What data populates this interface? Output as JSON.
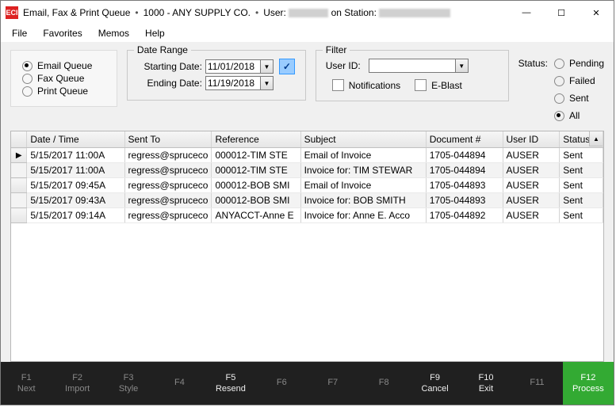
{
  "title": {
    "app_label": "ECI",
    "window_title": "Email, Fax & Print Queue",
    "account": "1000 - ANY SUPPLY CO.",
    "user_label": "User:",
    "station_label": "on Station:"
  },
  "menu": {
    "file": "File",
    "favorites": "Favorites",
    "memos": "Memos",
    "help": "Help"
  },
  "queue": {
    "email": "Email Queue",
    "fax": "Fax Queue",
    "print": "Print Queue",
    "selected": "email"
  },
  "daterange": {
    "legend": "Date Range",
    "start_lbl": "Starting Date:",
    "end_lbl": "Ending Date:",
    "start": "11/01/2018",
    "end": "11/19/2018"
  },
  "filter": {
    "legend": "Filter",
    "user_lbl": "User ID:",
    "user_value": "",
    "notifications": "Notifications",
    "eblast": "E-Blast"
  },
  "status": {
    "label": "Status:",
    "pending": "Pending",
    "failed": "Failed",
    "sent": "Sent",
    "all": "All",
    "selected": "all"
  },
  "grid": {
    "headers": {
      "datetime": "Date / Time",
      "sent_to": "Sent To",
      "reference": "Reference",
      "subject": "Subject",
      "document": "Document #",
      "user": "User ID",
      "status": "Status"
    },
    "rows": [
      {
        "dt": "5/15/2017 11:00A",
        "to": "regress@spruceco",
        "ref": "000012-TIM STE",
        "subj": "Email of Invoice",
        "doc": "1705-044894",
        "uid": "AUSER",
        "st": "Sent"
      },
      {
        "dt": "5/15/2017 11:00A",
        "to": "regress@spruceco",
        "ref": "000012-TIM STE",
        "subj": "Invoice for: TIM STEWAR",
        "doc": "1705-044894",
        "uid": "AUSER",
        "st": "Sent"
      },
      {
        "dt": "5/15/2017 09:45A",
        "to": "regress@spruceco",
        "ref": "000012-BOB SMI",
        "subj": "Email of Invoice",
        "doc": "1705-044893",
        "uid": "AUSER",
        "st": "Sent"
      },
      {
        "dt": "5/15/2017 09:43A",
        "to": "regress@spruceco",
        "ref": "000012-BOB SMI",
        "subj": "Invoice for: BOB SMITH",
        "doc": "1705-044893",
        "uid": "AUSER",
        "st": "Sent"
      },
      {
        "dt": "5/15/2017 09:14A",
        "to": "regress@spruceco",
        "ref": "ANYACCT-Anne E",
        "subj": "Invoice for: Anne E. Acco",
        "doc": "1705-044892",
        "uid": "AUSER",
        "st": "Sent"
      }
    ]
  },
  "fkeys": [
    {
      "code": "F1",
      "lbl": "Next",
      "enabled": false
    },
    {
      "code": "F2",
      "lbl": "Import",
      "enabled": false
    },
    {
      "code": "F3",
      "lbl": "Style",
      "enabled": false
    },
    {
      "code": "F4",
      "lbl": "",
      "enabled": false
    },
    {
      "code": "F5",
      "lbl": "Resend",
      "enabled": true
    },
    {
      "code": "F6",
      "lbl": "",
      "enabled": false
    },
    {
      "code": "F7",
      "lbl": "",
      "enabled": false
    },
    {
      "code": "F8",
      "lbl": "",
      "enabled": false
    },
    {
      "code": "F9",
      "lbl": "Cancel",
      "enabled": true
    },
    {
      "code": "F10",
      "lbl": "Exit",
      "enabled": true
    },
    {
      "code": "F11",
      "lbl": "",
      "enabled": false
    },
    {
      "code": "F12",
      "lbl": "Process",
      "enabled": true,
      "process": true
    }
  ]
}
